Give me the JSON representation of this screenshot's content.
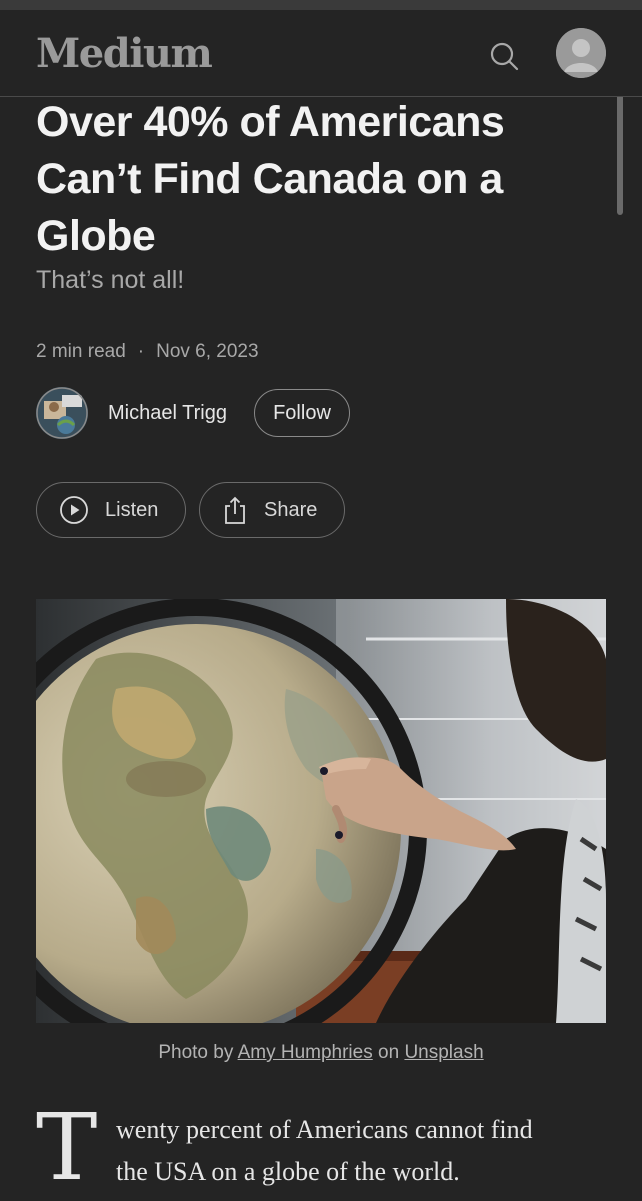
{
  "header": {
    "logo": "Medium",
    "search_icon": "search-icon",
    "avatar_icon": "user-avatar-icon"
  },
  "article": {
    "title": "Over 40% of Americans Can’t Find Canada on a Globe",
    "subtitle": "That’s not all!",
    "read_time": "2 min read",
    "separator": "·",
    "date": "Nov 6, 2023",
    "author": {
      "name": "Michael Trigg",
      "follow_label": "Follow"
    },
    "actions": {
      "listen_label": "Listen",
      "share_label": "Share",
      "listen_icon": "play-circle-icon",
      "share_icon": "share-icon"
    },
    "image": {
      "caption_prefix": "Photo by ",
      "photographer": "Amy Humphries",
      "caption_mid": " on ",
      "source": "Unsplash"
    },
    "body": {
      "dropcap": "T",
      "line1": "wenty percent of Americans cannot find",
      "line2": "the USA on a globe of the world."
    }
  },
  "colors": {
    "background": "#242424",
    "text": "#e6e6e6",
    "muted": "#a8a8a8"
  }
}
